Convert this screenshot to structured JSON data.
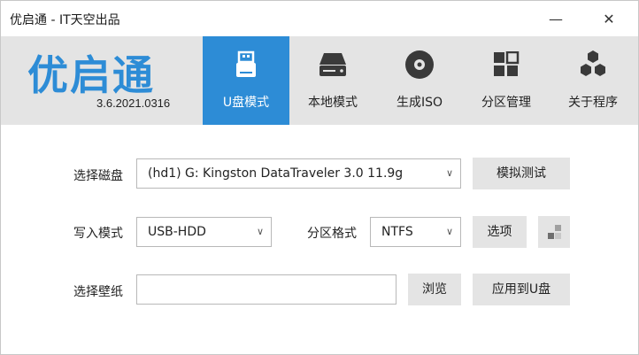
{
  "window": {
    "title": "优启通 - IT天空出品",
    "minimize_glyph": "—",
    "close_glyph": "✕"
  },
  "banner": {
    "logo_text": "优启通",
    "version": "3.6.2021.0316",
    "accent_color": "#2d8cd6"
  },
  "tabs": [
    {
      "label": "U盘模式",
      "icon": "usb-drive-icon",
      "active": true
    },
    {
      "label": "本地模式",
      "icon": "hard-drive-icon",
      "active": false
    },
    {
      "label": "生成ISO",
      "icon": "disc-icon",
      "active": false
    },
    {
      "label": "分区管理",
      "icon": "partition-grid-icon",
      "active": false
    },
    {
      "label": "关于程序",
      "icon": "hexagon-cluster-icon",
      "active": false
    }
  ],
  "form": {
    "disk_label": "选择磁盘",
    "disk_value": "(hd1) G: Kingston DataTraveler 3.0 11.9g",
    "simulate_button": "模拟测试",
    "write_mode_label": "写入模式",
    "write_mode_value": "USB-HDD",
    "partition_format_label": "分区格式",
    "partition_format_value": "NTFS",
    "options_button": "选项",
    "options_icon": "tiles-icon",
    "wallpaper_label": "选择壁纸",
    "wallpaper_value": "",
    "browse_button": "浏览",
    "apply_button": "应用到U盘",
    "chevron_glyph": "∨"
  }
}
